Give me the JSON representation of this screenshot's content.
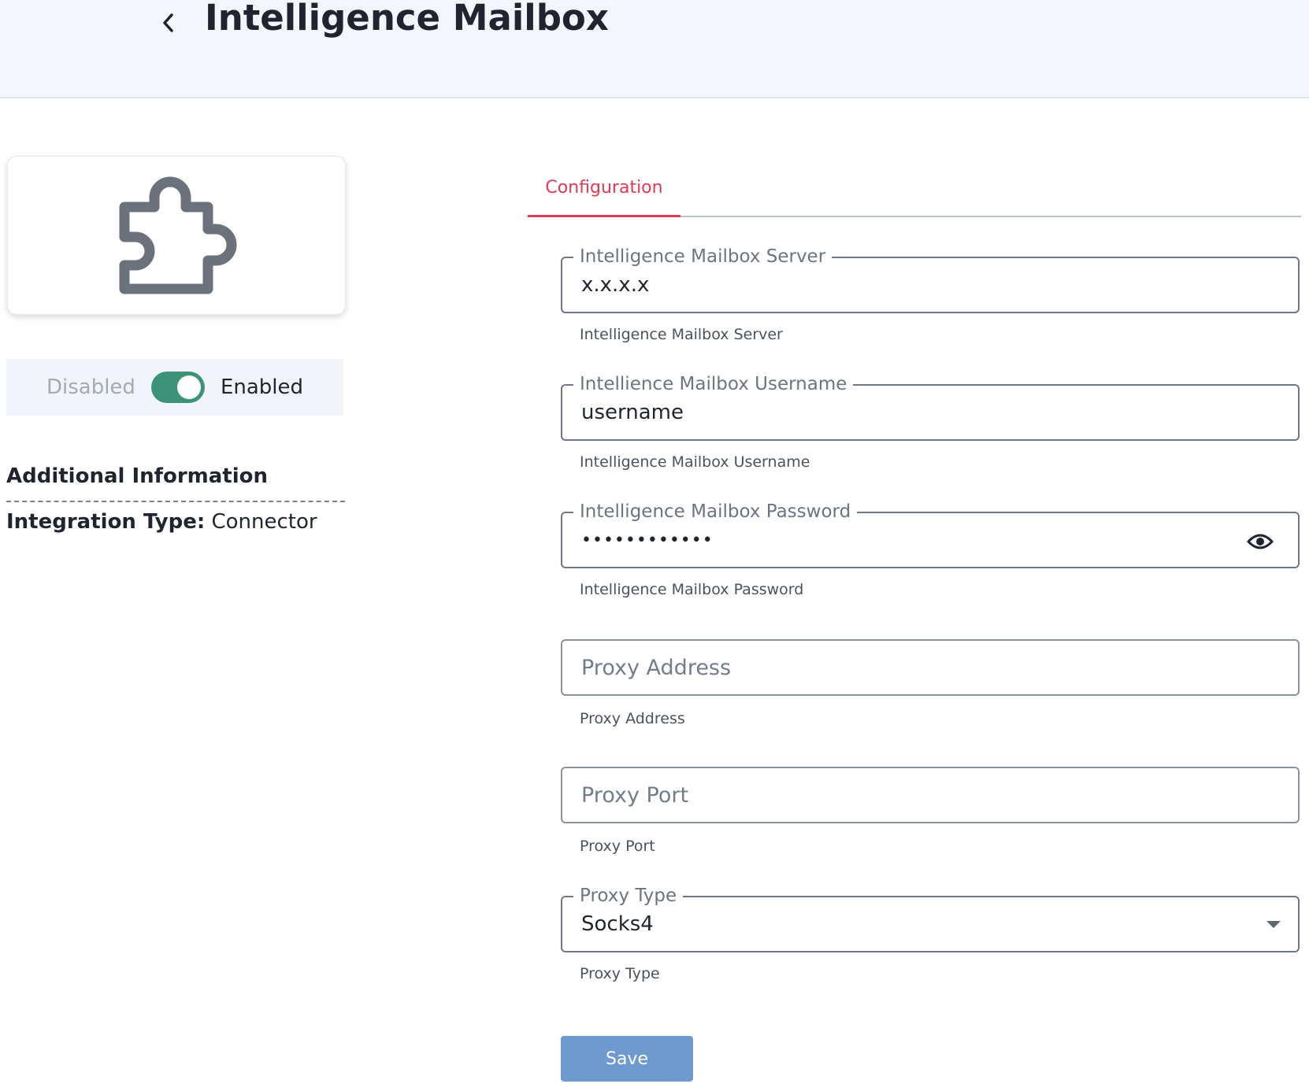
{
  "header": {
    "title": "Intelligence Mailbox",
    "back_icon": "chevron-left-icon"
  },
  "sidebar": {
    "logo_icon": "puzzle-piece-icon",
    "toggle": {
      "off_label": "Disabled",
      "on_label": "Enabled",
      "state": "enabled",
      "accent": "#3b9478"
    },
    "additional_info": {
      "title": "Additional Information",
      "integration_type_label": "Integration Type:",
      "integration_type_value": "Connector"
    }
  },
  "tabs": [
    {
      "label": "Configuration",
      "active": true,
      "color": "#e03a52"
    }
  ],
  "form": {
    "server": {
      "legend": "Intelligence Mailbox Server",
      "value": "x.x.x.x",
      "helper": "Intelligence Mailbox Server"
    },
    "username": {
      "legend": "Intellience Mailbox Username",
      "value": "username",
      "helper": "Intelligence Mailbox Username"
    },
    "password": {
      "legend": "Intelligence Mailbox Password",
      "value": "••••••••••••",
      "helper": "Intelligence Mailbox Password",
      "toggle_icon": "eye-icon"
    },
    "proxy_address": {
      "placeholder": "Proxy Address",
      "helper": "Proxy Address"
    },
    "proxy_port": {
      "placeholder": "Proxy Port",
      "helper": "Proxy Port"
    },
    "proxy_type": {
      "legend": "Proxy Type",
      "value": "Socks4",
      "helper": "Proxy Type",
      "caret_icon": "caret-down-icon"
    }
  },
  "actions": {
    "save_label": "Save",
    "save_color": "#6d9bd0"
  }
}
